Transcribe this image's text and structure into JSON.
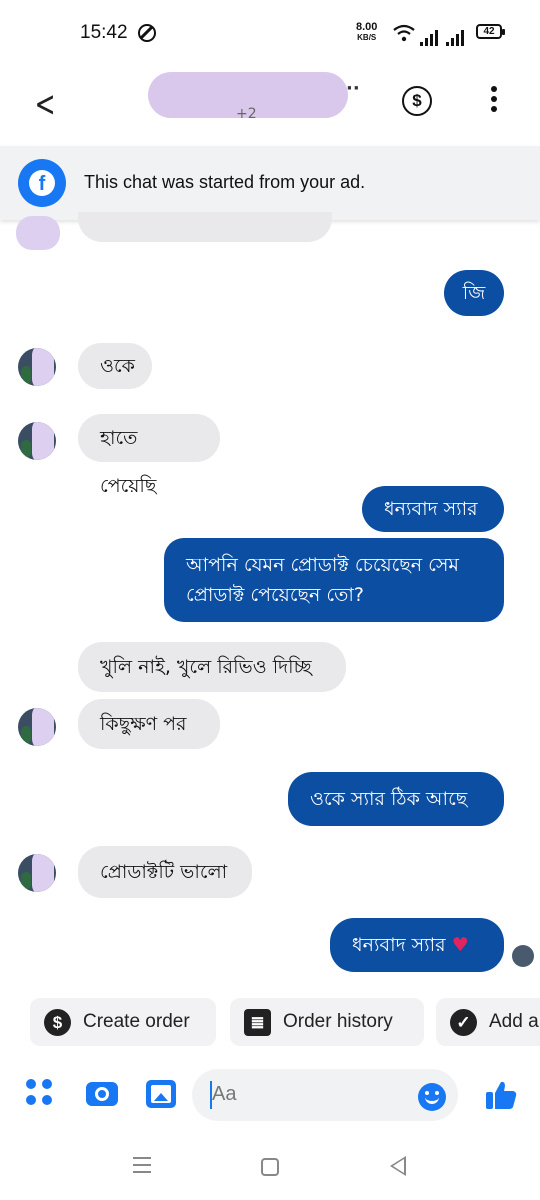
{
  "status_bar": {
    "time": "15:42",
    "net_speed_value": "8.00",
    "net_speed_unit": "KB/S",
    "battery": "42"
  },
  "header": {
    "subtitle": "+2",
    "title_trailing": "··"
  },
  "ad_banner": {
    "text": "This chat was started from your ad."
  },
  "messages": [
    {
      "side": "out",
      "text": "জি"
    },
    {
      "side": "in",
      "text": "ওকে"
    },
    {
      "side": "in",
      "text": "হাতে পেয়েছি"
    },
    {
      "side": "out",
      "text": "ধন্যবাদ স্যার"
    },
    {
      "side": "out",
      "text_line1": "আপনি যেমন প্রোডাক্ট চেয়েছেন সেম",
      "text_line2": "প্রোডাক্ট পেয়েছেন তো?"
    },
    {
      "side": "in",
      "text": "খুলি নাই, খুলে রিভিও দিচ্ছি"
    },
    {
      "side": "in",
      "text": "কিছুক্ষণ পর"
    },
    {
      "side": "out",
      "text": "ওকে স্যার ঠিক আছে"
    },
    {
      "side": "in",
      "text": "প্রোডাক্টটি ভালো"
    },
    {
      "side": "out",
      "text": "ধন্যবাদ স্যার",
      "emoji": "♥"
    }
  ],
  "quick_actions": [
    {
      "label": "Create order",
      "icon": "dollar-icon",
      "glyph": "$"
    },
    {
      "label": "Order history",
      "icon": "document-list-icon",
      "glyph": "≣"
    },
    {
      "label": "Add a",
      "icon": "check-circle-icon",
      "glyph": "✓"
    }
  ],
  "composer": {
    "placeholder": "Aa"
  },
  "colors": {
    "accent": "#1877f2",
    "outgoing_bubble": "#0b4ea2",
    "incoming_bubble": "#e9e9eb",
    "banner_bg": "#f1f2f4"
  }
}
